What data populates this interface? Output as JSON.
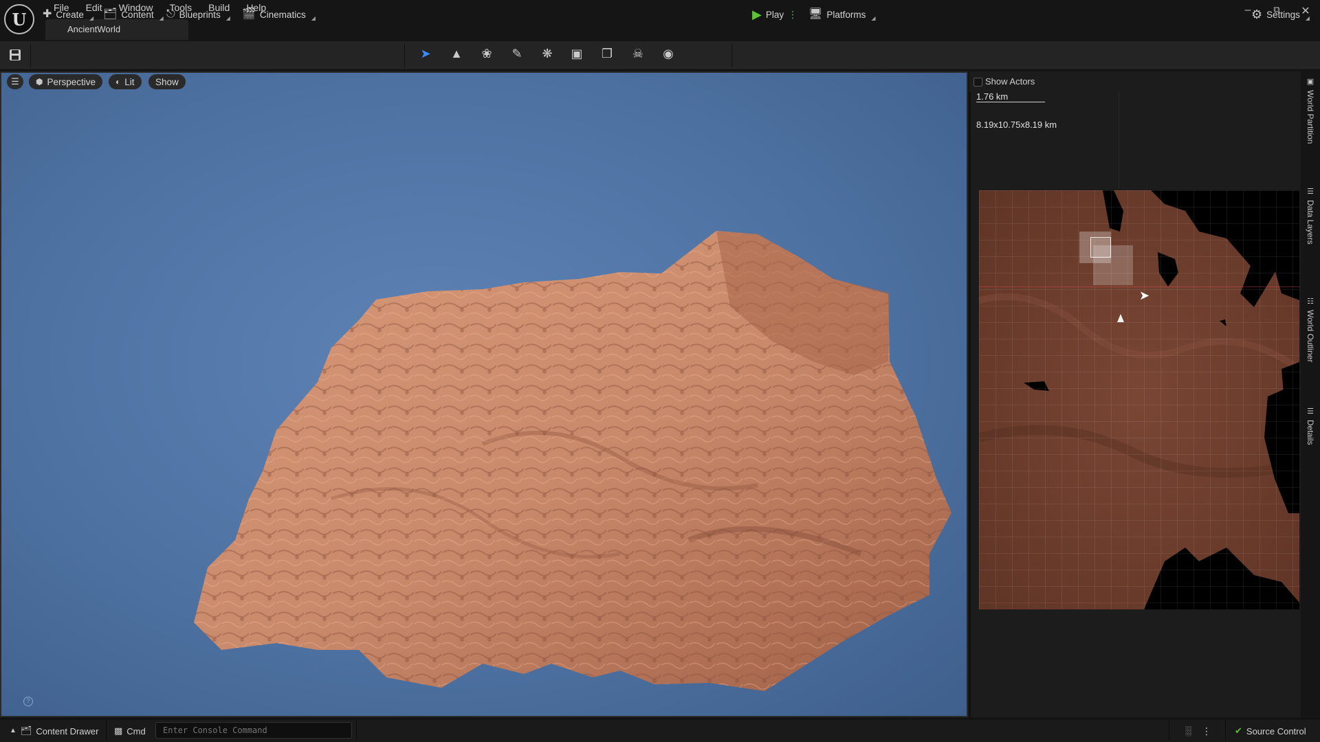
{
  "window": {
    "title": "AncientWorld"
  },
  "menu": [
    "File",
    "Edit",
    "Window",
    "Tools",
    "Build",
    "Help"
  ],
  "toolbar": {
    "create_label": "Create",
    "content_label": "Content",
    "blueprints_label": "Blueprints",
    "cinematics_label": "Cinematics",
    "play_label": "Play",
    "platforms_label": "Platforms",
    "settings_label": "Settings"
  },
  "viewport": {
    "perspective_label": "Perspective",
    "lit_label": "Lit",
    "show_label": "Show"
  },
  "world_partition": {
    "show_actors_label": "Show Actors",
    "scale_label": "1.76 km",
    "dimensions_label": "8.19x10.75x8.19 km"
  },
  "side_tabs": [
    "World Partition",
    "Data Layers",
    "World Outliner",
    "Details"
  ],
  "statusbar": {
    "content_drawer_label": "Content Drawer",
    "cmd_label": "Cmd",
    "console_placeholder": "Enter Console Command",
    "source_control_label": "Source Control"
  },
  "colors": {
    "play_green": "#5bc236",
    "selection_blue": "#3d8bff",
    "sky_blue": "#4f74a4",
    "terrain": "#c98a6c"
  }
}
